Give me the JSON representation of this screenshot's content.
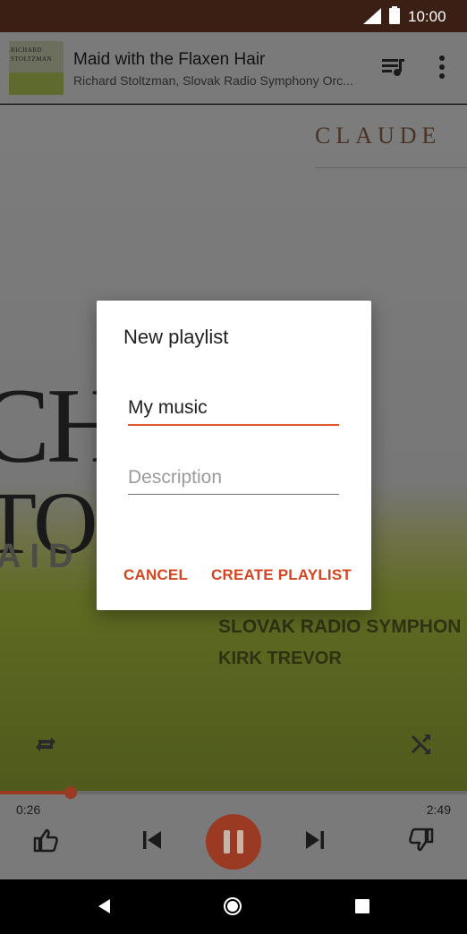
{
  "status_bar": {
    "time": "10:00"
  },
  "now_playing": {
    "title": "Maid with the Flaxen Hair",
    "artist": "Richard Stoltzman, Slovak Radio Symphony Orc...",
    "thumbnail_text": [
      "RICHARD",
      "STOLTZMAN"
    ],
    "queue_icon": "queue-music-icon",
    "more_icon": "more-vert-icon"
  },
  "album_art": {
    "word_claude": "CLAUDE",
    "word_big1": "CH",
    "word_big2": "TOL  M.",
    "word_band": "AID      XEN",
    "word_small1": "SLOVAK RADIO SYMPHON",
    "word_small2": "KIRK TREVOR",
    "repeat_icon": "repeat-icon",
    "shuffle_icon": "shuffle-icon"
  },
  "player": {
    "elapsed": "0:26",
    "total": "2:49",
    "progress": 0.151,
    "accent_color": "#9a3a22"
  },
  "dialog": {
    "title": "New playlist",
    "name_value": "My music",
    "description_placeholder": "Description",
    "cancel_label": "CANCEL",
    "create_label": "CREATE PLAYLIST",
    "accent_color": "#d4451f"
  }
}
